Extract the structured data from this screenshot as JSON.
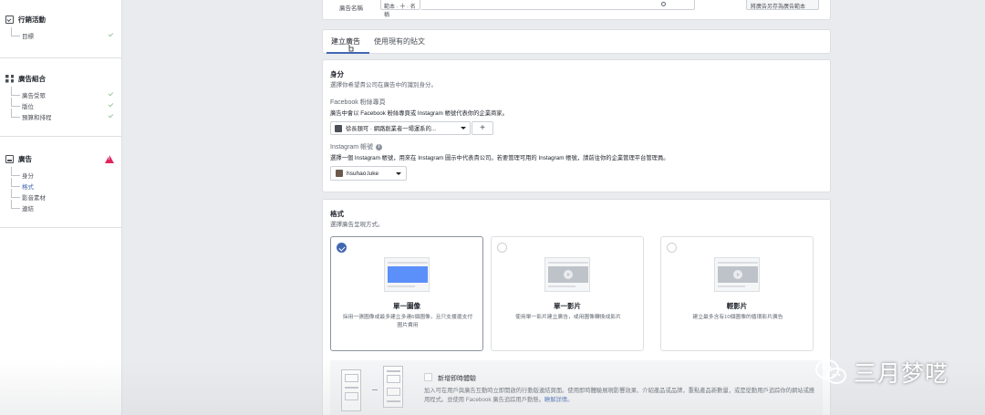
{
  "sidebar": {
    "campaign": {
      "title": "行銷活動",
      "items": [
        {
          "label": "目標",
          "done": true
        }
      ]
    },
    "adset": {
      "title": "廣告組合",
      "items": [
        {
          "label": "廣告受眾",
          "done": true
        },
        {
          "label": "版位",
          "done": true
        },
        {
          "label": "預算和排程",
          "done": true
        }
      ]
    },
    "ad": {
      "title": "廣告",
      "warning": true,
      "items": [
        {
          "label": "身分",
          "active": false
        },
        {
          "label": "格式",
          "active": true
        },
        {
          "label": "影音素材",
          "active": false
        },
        {
          "label": "連結",
          "active": false
        }
      ]
    }
  },
  "top_strip": {
    "label": "廣告名稱",
    "select_value": "範本 · 十 · 名稱",
    "button_label": "將廣告另存為廣告範本"
  },
  "tabs": [
    {
      "label": "建立廣告",
      "active": true
    },
    {
      "label": "使用現有的貼文",
      "active": false
    }
  ],
  "identity": {
    "title": "身分",
    "desc": "選擇你希望貴公司在廣告中的識別身分。",
    "fb_label": "Facebook 粉絲專頁",
    "fb_hint": "廣告中會以 Facebook 粉絲專頁或 Instagram 帳號代表你的企業商家。",
    "fb_page_value": "徐長頤可 · 網路創業者一場運系的...",
    "ig_label": "Instagram 帳號",
    "ig_hint": "選擇一個 Instagram 帳號，用來在 Instagram 圖示中代表貴公司。若要管理可用的 Instagram 帳號，請前往你的企業管理平台管理員。",
    "ig_value": "hsuhao.luke"
  },
  "format": {
    "title": "格式",
    "desc": "選擇廣告呈現方式。",
    "options": [
      {
        "name": "單一圖像",
        "desc": "採用一張圖像或最多建立多達6個圖像，且只支援還支付圖片費用",
        "selected": true,
        "media": "image"
      },
      {
        "name": "單一影片",
        "desc": "使用單一影片建立廣告，或用圖像轉換成影片",
        "selected": false,
        "media": "video"
      },
      {
        "name": "輕影片",
        "desc": "建立最多含有10個圖像的循環影片廣告",
        "selected": false,
        "media": "video"
      }
    ],
    "instant": {
      "title": "新增即時體驗",
      "desc": "加入可在用戶與廣告互動時立即開啟的行動版連結頁面。使用即時體驗展現影響效果、介紹產品或品牌，重點產品新數量，或是從動用戶追踪你的網站或應用程式。並使用 Facebook 廣告追踪用戶動態。",
      "link": "瞭解詳情。"
    }
  },
  "watermark": {
    "text": "三月梦呓"
  },
  "colors": {
    "accent": "#4267b2",
    "warning": "#e0245e",
    "background": "#e9ebee"
  }
}
